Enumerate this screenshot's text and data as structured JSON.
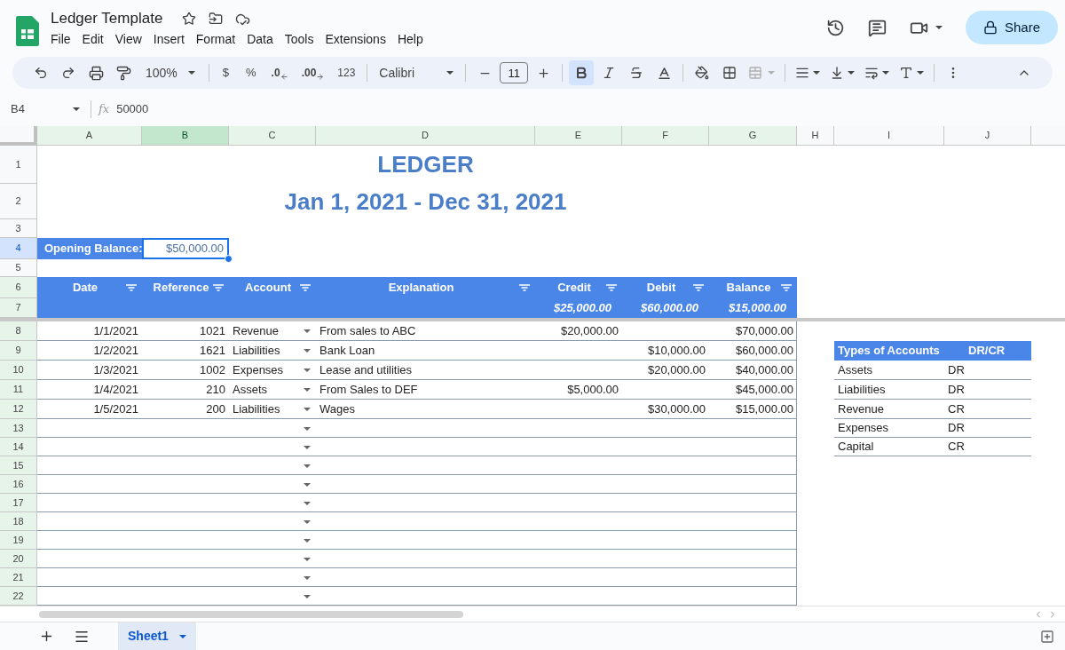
{
  "doc": {
    "title": "Ledger Template"
  },
  "menu": [
    "File",
    "Edit",
    "View",
    "Insert",
    "Format",
    "Data",
    "Tools",
    "Extensions",
    "Help"
  ],
  "share": "Share",
  "toolbar": {
    "zoom": "100%",
    "currency": "$",
    "percent": "%",
    "decrease_decimal": ".0",
    "increase_decimal": ".00",
    "number_format": "123",
    "font": "Calibri",
    "font_size": "11",
    "format_buttons": [
      {
        "kind": "bold",
        "selected": true
      },
      {
        "kind": "italic",
        "selected": false
      },
      {
        "kind": "strikethrough",
        "selected": false
      }
    ]
  },
  "formula_bar": {
    "cell_ref": "B4",
    "fx": "fx",
    "formula": "50000"
  },
  "columns": [
    {
      "label": "A",
      "selected": false,
      "filtered": true
    },
    {
      "label": "B",
      "selected": true,
      "filtered": true
    },
    {
      "label": "C",
      "selected": false,
      "filtered": true
    },
    {
      "label": "D",
      "selected": false,
      "filtered": true
    },
    {
      "label": "E",
      "selected": false,
      "filtered": true
    },
    {
      "label": "F",
      "selected": false,
      "filtered": true
    },
    {
      "label": "G",
      "selected": false,
      "filtered": true
    },
    {
      "label": "H",
      "selected": false,
      "filtered": false
    },
    {
      "label": "I",
      "selected": false,
      "filtered": false
    },
    {
      "label": "J",
      "selected": false,
      "filtered": false
    }
  ],
  "row_headers": [
    {
      "label": "1",
      "selected": false,
      "filtered": false
    },
    {
      "label": "2",
      "selected": false,
      "filtered": false
    },
    {
      "label": "3",
      "selected": false,
      "filtered": false
    },
    {
      "label": "4",
      "selected": true,
      "filtered": false
    },
    {
      "label": "5",
      "selected": false,
      "filtered": false
    },
    {
      "label": "6",
      "selected": false,
      "filtered": true
    },
    {
      "label": "7",
      "selected": false,
      "filtered": true
    },
    {
      "label": "8",
      "selected": false,
      "filtered": true
    },
    {
      "label": "9",
      "selected": false,
      "filtered": true
    },
    {
      "label": "10",
      "selected": false,
      "filtered": true
    },
    {
      "label": "11",
      "selected": false,
      "filtered": true
    },
    {
      "label": "12",
      "selected": false,
      "filtered": true
    },
    {
      "label": "13",
      "selected": false,
      "filtered": true
    },
    {
      "label": "14",
      "selected": false,
      "filtered": true
    },
    {
      "label": "15",
      "selected": false,
      "filtered": true
    },
    {
      "label": "16",
      "selected": false,
      "filtered": true
    },
    {
      "label": "17",
      "selected": false,
      "filtered": true
    },
    {
      "label": "18",
      "selected": false,
      "filtered": true
    },
    {
      "label": "19",
      "selected": false,
      "filtered": true
    },
    {
      "label": "20",
      "selected": false,
      "filtered": true
    },
    {
      "label": "21",
      "selected": false,
      "filtered": true
    },
    {
      "label": "22",
      "selected": false,
      "filtered": true
    }
  ],
  "sheet": {
    "title": "LEDGER",
    "subtitle": "Jan 1, 2021 - Dec 31, 2021",
    "opening_balance": {
      "label": "Opening Balance:",
      "value": "$50,000.00",
      "selected": true
    },
    "ledger_headers": [
      {
        "label": "Date",
        "filter": true
      },
      {
        "label": "Reference",
        "filter": true
      },
      {
        "label": "Account",
        "filter": true
      },
      {
        "label": "Explanation",
        "filter": true
      },
      {
        "label": "Credit",
        "filter": true,
        "total": "$25,000.00"
      },
      {
        "label": "Debit",
        "filter": true,
        "total": "$60,000.00"
      },
      {
        "label": "Balance",
        "filter": true,
        "total": "$15,000.00"
      }
    ],
    "ledger_rows": [
      {
        "date": "1/1/2021",
        "reference": "1021",
        "account": "Revenue",
        "dropdown": true,
        "explanation": "From sales to ABC",
        "credit": "$20,000.00",
        "balance": "$70,000.00"
      },
      {
        "date": "1/2/2021",
        "reference": "1621",
        "account": "Liabilities",
        "dropdown": true,
        "explanation": "Bank Loan",
        "debit": "$10,000.00",
        "balance": "$60,000.00"
      },
      {
        "date": "1/3/2021",
        "reference": "1002",
        "account": "Expenses",
        "dropdown": true,
        "explanation": "Lease and utilities",
        "debit": "$20,000.00",
        "balance": "$40,000.00"
      },
      {
        "date": "1/4/2021",
        "reference": "210",
        "account": "Assets",
        "dropdown": true,
        "explanation": "From Sales to DEF",
        "credit": "$5,000.00",
        "balance": "$45,000.00"
      },
      {
        "date": "1/5/2021",
        "reference": "200",
        "account": "Liabilities",
        "dropdown": true,
        "explanation": "Wages",
        "debit": "$30,000.00",
        "balance": "$15,000.00"
      },
      {
        "dropdown": true
      },
      {
        "dropdown": true
      },
      {
        "dropdown": true
      },
      {
        "dropdown": true
      },
      {
        "dropdown": true
      },
      {
        "dropdown": true
      },
      {
        "dropdown": true
      },
      {
        "dropdown": true
      },
      {
        "dropdown": true
      },
      {
        "dropdown": true
      }
    ],
    "account_types": {
      "headers": [
        "Types of Accounts",
        "DR/CR"
      ],
      "rows": [
        [
          "Assets",
          "DR"
        ],
        [
          "Liabilities",
          "DR"
        ],
        [
          "Revenue",
          "CR"
        ],
        [
          "Expenses",
          "DR"
        ],
        [
          "Capital",
          "CR"
        ]
      ]
    }
  },
  "sheet_tabs": [
    {
      "label": "Sheet1",
      "selected": true
    }
  ]
}
